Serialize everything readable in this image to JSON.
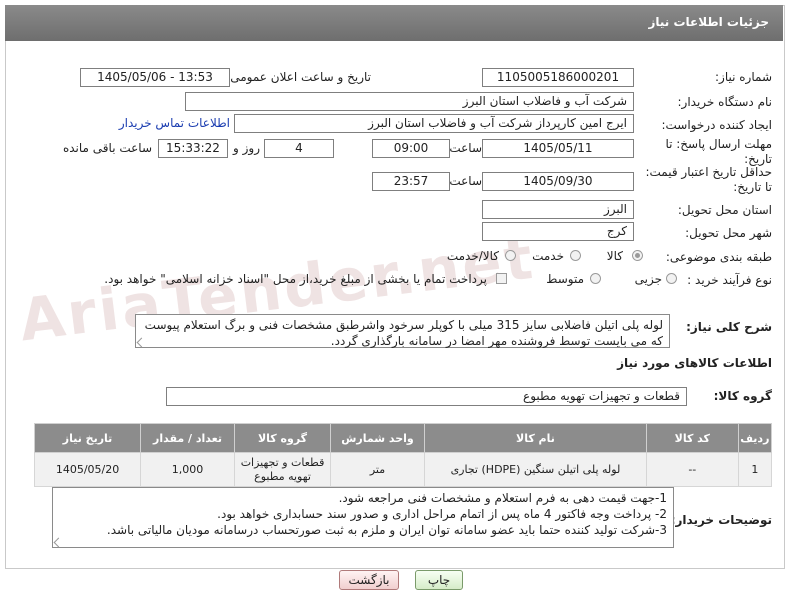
{
  "header": {
    "title": "جزئیات اطلاعات نیاز"
  },
  "watermark": {
    "text": "AriaTender.net"
  },
  "labels": {
    "need_number": "شماره نیاز:",
    "announce_datetime": "تاریخ و ساعت اعلان عمومی:",
    "buyer_org": "نام دستگاه خریدار:",
    "requester": "ایجاد کننده درخواست:",
    "buyer_contact": "اطلاعات تماس خریدار",
    "reply_deadline": "مهلت ارسال پاسخ: تا تاریخ:",
    "time": "ساعت",
    "day_and": "روز و",
    "hours_left": "ساعت باقی مانده",
    "price_validity": "حداقل تاریخ اعتبار قیمت: تا تاریخ:",
    "delivery_province": "استان محل تحویل:",
    "delivery_city": "شهر محل تحویل:",
    "category": "طبقه بندی موضوعی:",
    "purchase_type": "نوع فرآیند خرید :",
    "description": "شرح کلی نیاز:",
    "goods_info": "اطلاعات کالاهای مورد نیاز",
    "goods_group": "گروه کالا:",
    "buyer_notes": "توضیحات خریدار:"
  },
  "fields": {
    "need_number": "1105005186000201",
    "announce_datetime": "1405/05/06 - 13:53",
    "buyer_org": "شرکت آب و فاضلاب استان البرز",
    "requester": "ایرج امین کارپرداز شرکت آب و فاضلاب استان البرز",
    "reply_date": "1405/05/11",
    "reply_time": "09:00",
    "days_left": "4",
    "remaining_time": "15:33:22",
    "validity_date": "1405/09/30",
    "validity_time": "23:57",
    "delivery_province": "البرز",
    "delivery_city": "کرج",
    "goods_group": "قطعات و تجهیزات تهویه مطبوع"
  },
  "category_options": [
    {
      "label": "کالا",
      "selected": true
    },
    {
      "label": "خدمت",
      "selected": false
    },
    {
      "label": "کالا/خدمت",
      "selected": false
    }
  ],
  "purchase_options": [
    {
      "label": "جزیی",
      "selected": false
    },
    {
      "label": "متوسط",
      "selected": false
    }
  ],
  "payment_note": "پرداخت تمام یا بخشی از مبلغ خرید،از محل \"اسناد خزانه اسلامی\" خواهد بود.",
  "description": "لوله پلی اتیلن فاضلابی سایز 315 میلی با کوپلر سرخود واشرطبق مشخصات فنی و برگ استعلام پیوست که می بایست توسط فروشنده مهر امضا در سامانه بارگذاری گردد.",
  "table": {
    "headers": [
      "ردیف",
      "کد کالا",
      "نام کالا",
      "واحد شمارش",
      "گروه کالا",
      "تعداد / مقدار",
      "تاریخ نیاز"
    ],
    "rows": [
      [
        "1",
        "--",
        "لوله پلی اتیلن سنگین (HDPE) تجاری",
        "متر",
        "قطعات و تجهیزات تهویه مطبوع",
        "1,000",
        "1405/05/20"
      ]
    ]
  },
  "buyer_notes": [
    "1-جهت قیمت دهی به فرم استعلام و مشخصات فنی مراجعه شود.",
    "2- پرداخت وجه فاکتور 4 ماه پس از اتمام مراحل اداری و صدور سند حسابداری خواهد بود.",
    "3-شرکت تولید کننده حتما باید عضو سامانه توان ایران و ملزم به ثبت صورتحساب درسامانه مودیان مالیاتی باشد."
  ],
  "buttons": {
    "print": "چاپ",
    "back": "بازگشت"
  }
}
